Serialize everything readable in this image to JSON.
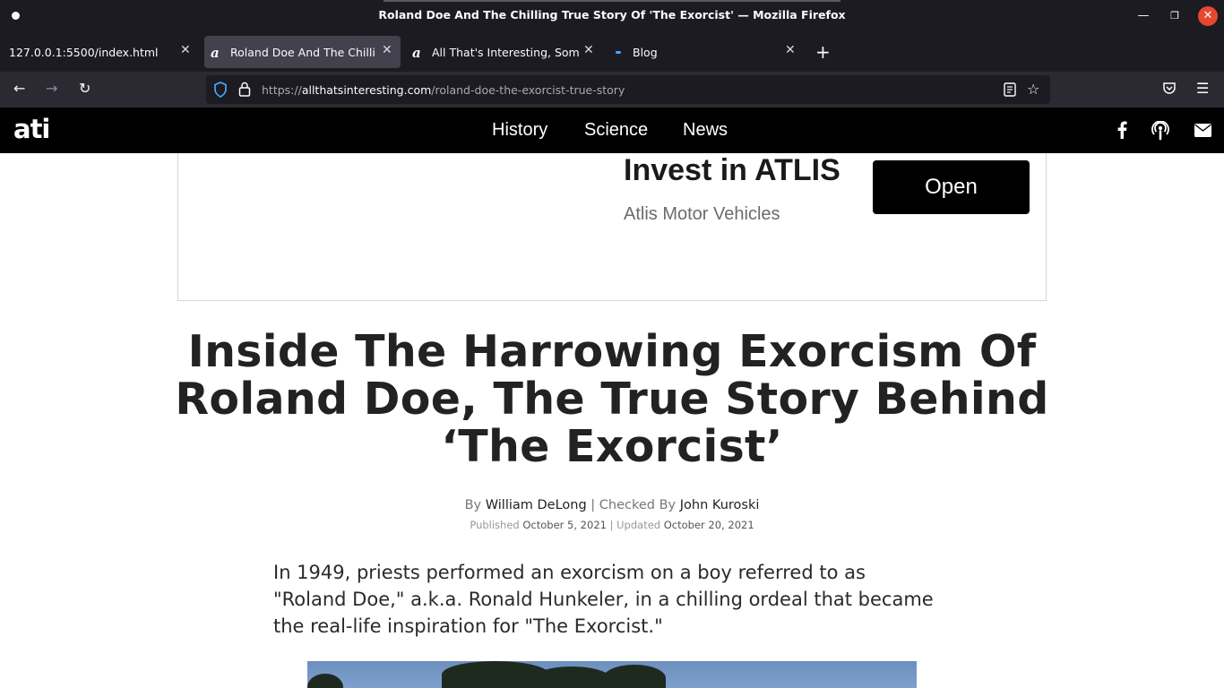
{
  "window": {
    "title": "Roland Doe And The Chilling True Story Of 'The Exorcist' — Mozilla Firefox"
  },
  "tabs": [
    {
      "label": "127.0.0.1:5500/index.html",
      "active": false
    },
    {
      "label": "Roland Doe And The Chilling True",
      "active": true
    },
    {
      "label": "All That's Interesting, Something",
      "active": false
    },
    {
      "label": "Blog",
      "active": false
    }
  ],
  "navbar": {
    "url_prefix": "https://",
    "url_host": "allthatsinteresting.com",
    "url_path": "/roland-doe-the-exorcist-true-story"
  },
  "site": {
    "logo": "ati",
    "nav": [
      "History",
      "Science",
      "News"
    ],
    "social_icons": [
      "facebook-icon",
      "podcast-icon",
      "email-icon"
    ]
  },
  "ad": {
    "title": "Invest in ATLIS",
    "subtitle": "Atlis Motor Vehicles",
    "button": "Open"
  },
  "article": {
    "headline": "Inside The Harrowing Exorcism Of Roland Doe, The True Story Behind ‘The Exorcist’",
    "by_label": "By",
    "author": "William DeLong",
    "checked_label": "| Checked By",
    "checker": "John Kuroski",
    "published_label": "Published",
    "published": "October 5, 2021",
    "separator": "|",
    "updated_label": "Updated",
    "updated": "October 20, 2021",
    "lede": "In 1949, priests performed an exorcism on a boy referred to as \"Roland Doe,\" a.k.a. Ronald Hunkeler, in a chilling ordeal that became the real-life inspiration for \"The Exorcist.\""
  }
}
